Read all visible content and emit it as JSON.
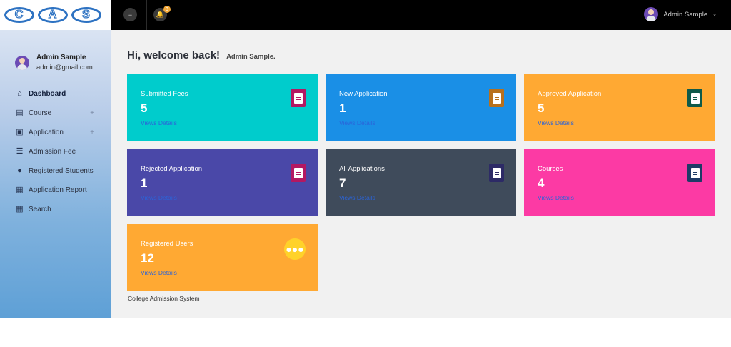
{
  "brand": {
    "logo_letters": [
      "C",
      "A",
      "S"
    ]
  },
  "topbar": {
    "notification_count": "3",
    "user_name": "Admin Sample"
  },
  "sidebar": {
    "user_name": "Admin Sample",
    "user_email": "admin@gmail.com",
    "items": [
      {
        "label": "Dashboard",
        "icon": "home-icon",
        "active": true,
        "expandable": false
      },
      {
        "label": "Course",
        "icon": "document-icon",
        "active": false,
        "expandable": true
      },
      {
        "label": "Application",
        "icon": "id-card-icon",
        "active": false,
        "expandable": true
      },
      {
        "label": "Admission Fee",
        "icon": "list-icon",
        "active": false,
        "expandable": false
      },
      {
        "label": "Registered Students",
        "icon": "people-icon",
        "active": false,
        "expandable": false
      },
      {
        "label": "Application Report",
        "icon": "table-icon",
        "active": false,
        "expandable": false
      },
      {
        "label": "Search",
        "icon": "grid-icon",
        "active": false,
        "expandable": false
      }
    ]
  },
  "main": {
    "welcome": "Hi, welcome back!",
    "welcome_user": "Admin Sample.",
    "link_label": "Views Details",
    "cards": [
      {
        "title": "Submitted Fees",
        "value": "5",
        "color": "#00cccc",
        "icon_bg": "#b31862"
      },
      {
        "title": "New Application",
        "value": "1",
        "color": "#1a8fe6",
        "icon_bg": "#b8701c"
      },
      {
        "title": "Approved Application",
        "value": "5",
        "color": "#ffa933",
        "icon_bg": "#0e5a4a"
      },
      {
        "title": "Rejected Application",
        "value": "1",
        "color": "#4a48a8",
        "icon_bg": "#b31862"
      },
      {
        "title": "All Applications",
        "value": "7",
        "color": "#3f4b5b",
        "icon_bg": "#2d2a66"
      },
      {
        "title": "Courses",
        "value": "4",
        "color": "#fc3aa4",
        "icon_bg": "#1e3b66"
      },
      {
        "title": "Registered Users",
        "value": "12",
        "color": "#ffa933",
        "icon_bg": "#ffd22a"
      }
    ],
    "footer": "College Admission System"
  }
}
